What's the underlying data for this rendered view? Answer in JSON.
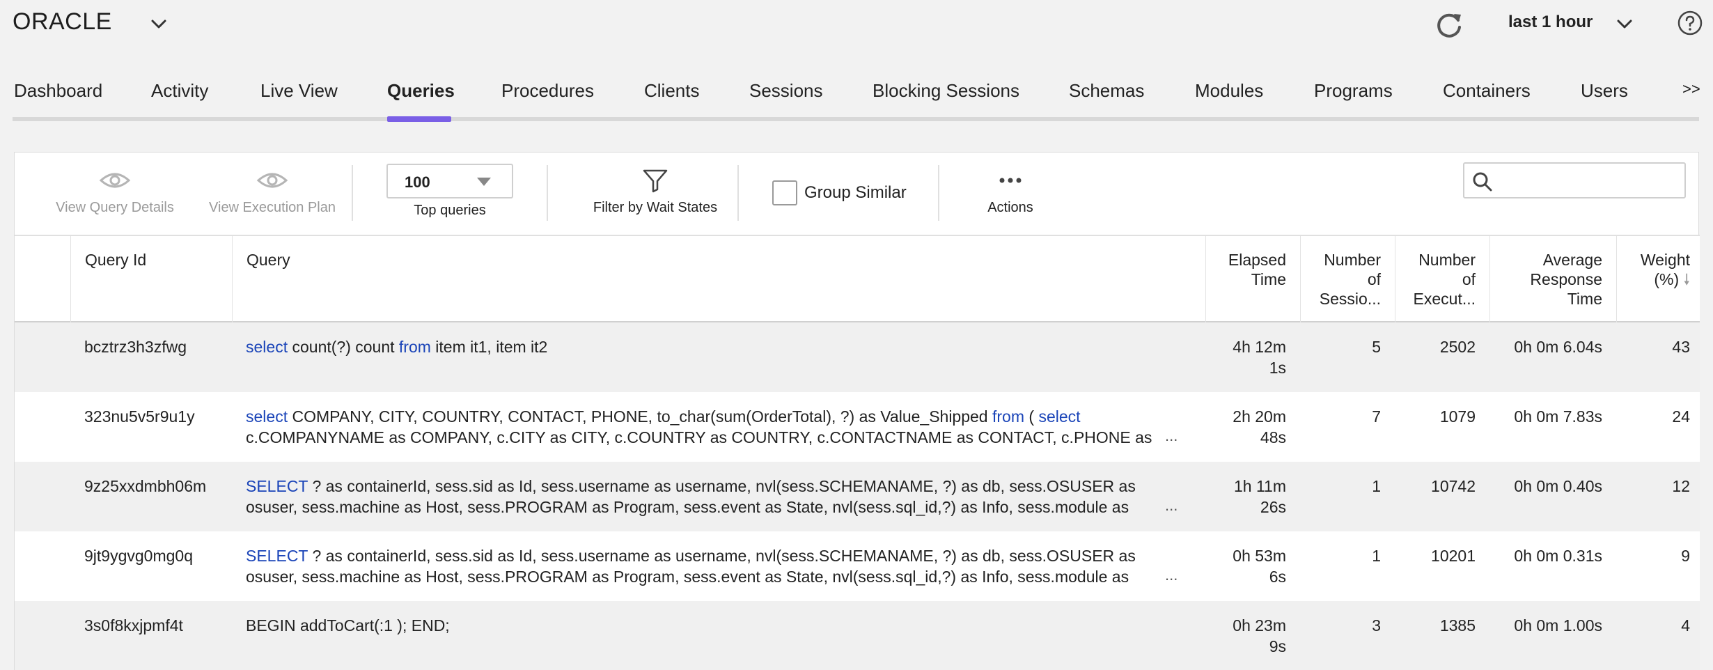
{
  "header": {
    "brand": "ORACLE",
    "time_range": "last 1 hour"
  },
  "tabs": [
    {
      "label": "Dashboard",
      "active": false
    },
    {
      "label": "Activity",
      "active": false
    },
    {
      "label": "Live View",
      "active": false
    },
    {
      "label": "Queries",
      "active": true
    },
    {
      "label": "Procedures",
      "active": false
    },
    {
      "label": "Clients",
      "active": false
    },
    {
      "label": "Sessions",
      "active": false
    },
    {
      "label": "Blocking Sessions",
      "active": false
    },
    {
      "label": "Schemas",
      "active": false
    },
    {
      "label": "Modules",
      "active": false
    },
    {
      "label": "Programs",
      "active": false
    },
    {
      "label": "Containers",
      "active": false
    },
    {
      "label": "Users",
      "active": false
    }
  ],
  "tabs_more": ">>",
  "toolbar": {
    "view_query_details": "View Query Details",
    "view_execution_plan": "View Execution Plan",
    "top_queries_value": "100",
    "top_queries_label": "Top queries",
    "filter_label": "Filter by Wait States",
    "group_similar_label": "Group Similar",
    "group_similar_checked": false,
    "actions_label": "Actions",
    "search_value": ""
  },
  "table": {
    "headers": {
      "query_id": "Query Id",
      "query": "Query",
      "elapsed_1": "Elapsed",
      "elapsed_2": "Time",
      "sessions_1": "Number",
      "sessions_2": "of",
      "sessions_3": "Sessio...",
      "executions_1": "Number",
      "executions_2": "of",
      "executions_3": "Execut...",
      "avg_1": "Average",
      "avg_2": "Response",
      "avg_3": "Time",
      "weight_1": "Weight",
      "weight_2": "(%)"
    },
    "rows": [
      {
        "query_id": "bcztrz3h3zfwg",
        "kw1": "select",
        "q1": " count(?) count ",
        "kw2": "from",
        "q2": " item it1, item it2",
        "kw3": "",
        "q3": "",
        "elapsed_1": "4h 12m",
        "elapsed_2": "1s",
        "sessions": "5",
        "executions": "2502",
        "avg_response": "0h 0m 6.04s",
        "weight": "43",
        "truncated": false
      },
      {
        "query_id": "323nu5v5r9u1y",
        "kw1": "select",
        "q1": " COMPANY, CITY, COUNTRY, CONTACT, PHONE, to_char(sum(OrderTotal), ?) as Value_Shipped ",
        "kw2": "from",
        "q2": " ( ",
        "kw3": "select",
        "q3": " c.COMPANYNAME as COMPANY, c.CITY as CITY, c.COUNTRY as COUNTRY, c.CONTACTNAME as CONTACT, c.PHONE as",
        "elapsed_1": "2h 20m",
        "elapsed_2": "48s",
        "sessions": "7",
        "executions": "1079",
        "avg_response": "0h 0m 7.83s",
        "weight": "24",
        "truncated": true
      },
      {
        "query_id": "9z25xxdmbh06m",
        "kw1": "SELECT",
        "q1": " ? as containerId, sess.sid as Id, sess.username as username, nvl(sess.SCHEMANAME, ?) as db, sess.OSUSER as osuser, sess.machine as Host, sess.PROGRAM as Program, sess.event as State, nvl(sess.sql_id,?) as Info, sess.module as",
        "kw2": "",
        "q2": "",
        "kw3": "",
        "q3": "",
        "elapsed_1": "1h 11m",
        "elapsed_2": "26s",
        "sessions": "1",
        "executions": "10742",
        "avg_response": "0h 0m 0.40s",
        "weight": "12",
        "truncated": true
      },
      {
        "query_id": "9jt9ygvg0mg0q",
        "kw1": "SELECT",
        "q1": " ? as containerId, sess.sid as Id, sess.username as username, nvl(sess.SCHEMANAME, ?) as db, sess.OSUSER as osuser, sess.machine as Host, sess.PROGRAM as Program, sess.event as State, nvl(sess.sql_id,?) as Info, sess.module as",
        "kw2": "",
        "q2": "",
        "kw3": "",
        "q3": "",
        "elapsed_1": "0h 53m",
        "elapsed_2": "6s",
        "sessions": "1",
        "executions": "10201",
        "avg_response": "0h 0m 0.31s",
        "weight": "9",
        "truncated": true
      },
      {
        "query_id": "3s0f8kxjpmf4t",
        "kw1": "",
        "q1": "BEGIN addToCart(:1 ); END;",
        "kw2": "",
        "q2": "",
        "kw3": "",
        "q3": "",
        "elapsed_1": "0h 23m",
        "elapsed_2": "9s",
        "sessions": "3",
        "executions": "1385",
        "avg_response": "0h 0m 1.00s",
        "weight": "4",
        "truncated": false
      }
    ],
    "ellipsis": "..."
  },
  "icons": {
    "brand_caret": "chevron-down-icon",
    "refresh": "refresh-icon",
    "range_caret": "chevron-down-icon",
    "help": "help-icon",
    "view": "eye-icon",
    "filter": "funnel-icon",
    "actions": "more-horizontal-icon",
    "search": "search-icon",
    "sort": "arrow-down-icon"
  },
  "colors": {
    "accent": "#7a5fe6",
    "keyword": "#1a44b8",
    "row_alt": "#f0f0f0"
  }
}
